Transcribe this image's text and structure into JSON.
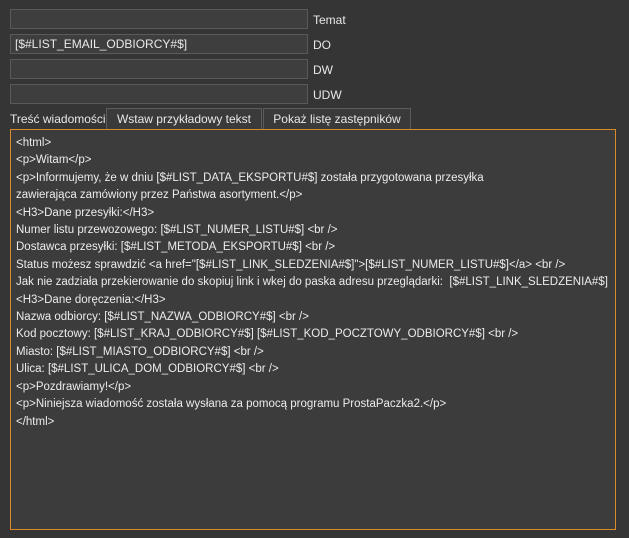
{
  "fields": {
    "temat": {
      "value": "",
      "label": "Temat"
    },
    "do": {
      "value": "[$#LIST_EMAIL_ODBIORCY#$]",
      "label": "DO"
    },
    "dw": {
      "value": "",
      "label": "DW"
    },
    "udw": {
      "value": "",
      "label": "UDW"
    }
  },
  "toolbar": {
    "label": "Treść wiadomości:",
    "insert_sample_label": "Wstaw przykładowy tekst",
    "show_placeholders_label": "Pokaż listę zastępników"
  },
  "editor": {
    "accent_color": "#d98a2b",
    "lines": [
      "<html>",
      "<p>Witam</p>",
      "<p>Informujemy, że w dniu [$#LIST_DATA_EKSPORTU#$] została przygotowana przesyłka",
      "zawierająca zamówiony przez Państwa asortyment.</p>",
      "<H3>Dane przesyłki:</H3>",
      "Numer listu przewozowego: [$#LIST_NUMER_LISTU#$] <br />",
      "Dostawca przesyłki: [$#LIST_METODA_EKSPORTU#$] <br />",
      "Status możesz sprawdzić <a href=\"[$#LIST_LINK_SLEDZENIA#$]\">[$#LIST_NUMER_LISTU#$]</a> <br />",
      "Jak nie zadziała przekierowanie do skopiuj link i wkej do paska adresu przeglądarki:  [$#LIST_LINK_SLEDZENIA#$]",
      "<H3>Dane doręczenia:</H3>",
      "Nazwa odbiorcy: [$#LIST_NAZWA_ODBIORCY#$] <br />",
      "Kod pocztowy: [$#LIST_KRAJ_ODBIORCY#$] [$#LIST_KOD_POCZTOWY_ODBIORCY#$] <br />",
      "Miasto: [$#LIST_MIASTO_ODBIORCY#$] <br />",
      "Ulica: [$#LIST_ULICA_DOM_ODBIORCY#$] <br />",
      "<p>Pozdrawiamy!</p>",
      "<p>Niniejsza wiadomość została wysłana za pomocą programu ProstaPaczka2.</p>",
      "</html>"
    ]
  }
}
